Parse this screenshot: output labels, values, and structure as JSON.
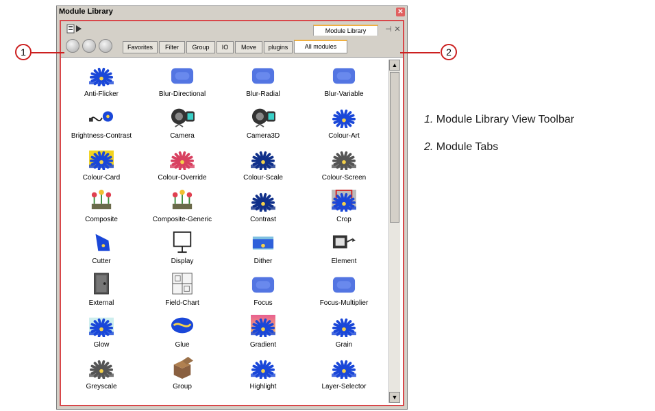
{
  "window": {
    "title": "Module Library"
  },
  "view_tab": {
    "label": "Module Library"
  },
  "tabs": [
    "Favorites",
    "Filter",
    "Group",
    "IO",
    "Move",
    "plugins",
    "All modules"
  ],
  "active_tab": "All modules",
  "modules": [
    {
      "label": "Anti-Flicker",
      "icon": "flower-icon"
    },
    {
      "label": "Blur-Directional",
      "icon": "blur-directional-icon"
    },
    {
      "label": "Blur-Radial",
      "icon": "blur-radial-icon"
    },
    {
      "label": "Blur-Variable",
      "icon": "blur-variable-icon"
    },
    {
      "label": "Brightness-Contrast",
      "icon": "plug-icon"
    },
    {
      "label": "Camera",
      "icon": "camera-icon"
    },
    {
      "label": "Camera3D",
      "icon": "camera3d-icon"
    },
    {
      "label": "Colour-Art",
      "icon": "colour-art-icon"
    },
    {
      "label": "Colour-Card",
      "icon": "colour-card-icon"
    },
    {
      "label": "Colour-Override",
      "icon": "colour-override-icon"
    },
    {
      "label": "Colour-Scale",
      "icon": "colour-scale-icon"
    },
    {
      "label": "Colour-Screen",
      "icon": "colour-screen-icon"
    },
    {
      "label": "Composite",
      "icon": "composite-icon"
    },
    {
      "label": "Composite-Generic",
      "icon": "composite-generic-icon"
    },
    {
      "label": "Contrast",
      "icon": "contrast-icon"
    },
    {
      "label": "Crop",
      "icon": "crop-icon"
    },
    {
      "label": "Cutter",
      "icon": "cutter-icon"
    },
    {
      "label": "Display",
      "icon": "display-icon"
    },
    {
      "label": "Dither",
      "icon": "dither-icon"
    },
    {
      "label": "Element",
      "icon": "element-icon"
    },
    {
      "label": "External",
      "icon": "external-icon"
    },
    {
      "label": "Field-Chart",
      "icon": "field-chart-icon"
    },
    {
      "label": "Focus",
      "icon": "focus-icon"
    },
    {
      "label": "Focus-Multiplier",
      "icon": "focus-multiplier-icon"
    },
    {
      "label": "Glow",
      "icon": "glow-icon"
    },
    {
      "label": "Glue",
      "icon": "glue-icon"
    },
    {
      "label": "Gradient",
      "icon": "gradient-icon"
    },
    {
      "label": "Grain",
      "icon": "grain-icon"
    },
    {
      "label": "Greyscale",
      "icon": "greyscale-icon"
    },
    {
      "label": "Group",
      "icon": "group-icon"
    },
    {
      "label": "Highlight",
      "icon": "highlight-icon"
    },
    {
      "label": "Layer-Selector",
      "icon": "layer-selector-icon"
    }
  ],
  "callouts": {
    "one": "1",
    "two": "2"
  },
  "legend": [
    {
      "num": "1.",
      "text": "Module Library View Toolbar"
    },
    {
      "num": "2.",
      "text": "Module Tabs"
    }
  ],
  "colors": {
    "frame_border": "#d8474a",
    "flower_blue": "#1a47d8",
    "callout_red": "#cc2020"
  }
}
